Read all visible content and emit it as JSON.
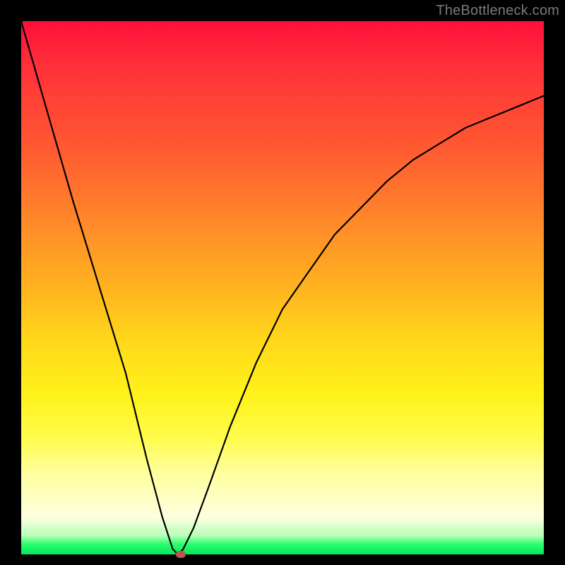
{
  "watermark": "TheBottleneck.com",
  "colors": {
    "frame_bg": "#000000",
    "gradient_top": "#ff0f3a",
    "gradient_mid": "#ffd81a",
    "gradient_bottom": "#00e85c",
    "curve_stroke": "#000000",
    "marker_fill": "#b55a4a"
  },
  "chart_data": {
    "type": "line",
    "title": "",
    "xlabel": "",
    "ylabel": "",
    "xlim": [
      0,
      100
    ],
    "ylim": [
      0,
      100
    ],
    "series": [
      {
        "name": "bottleneck-curve",
        "x": [
          0,
          5,
          10,
          15,
          20,
          24,
          27,
          29,
          30,
          31,
          33,
          36,
          40,
          45,
          50,
          55,
          60,
          65,
          70,
          75,
          80,
          85,
          90,
          95,
          100
        ],
        "values": [
          100,
          83,
          66,
          50,
          34,
          18,
          7,
          1,
          0,
          1,
          5,
          13,
          24,
          36,
          46,
          53,
          60,
          65,
          70,
          74,
          77,
          80,
          82,
          84,
          86
        ]
      }
    ],
    "marker": {
      "x": 30.5,
      "y": 0
    }
  }
}
